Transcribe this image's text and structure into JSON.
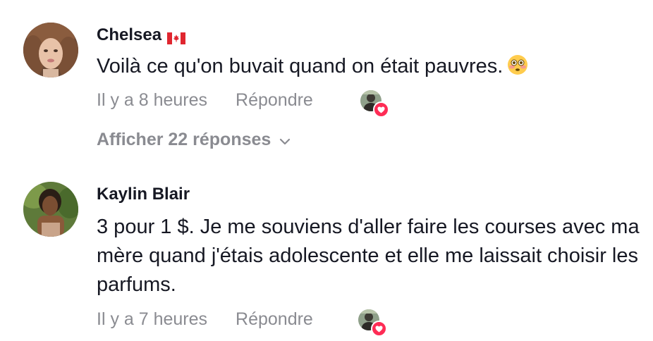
{
  "comments": [
    {
      "username": "Chelsea",
      "flag_icon": "canada-flag-icon",
      "text": "Voilà ce qu'on buvait quand on était pauvres.",
      "emoji_icon": "flushed-face-emoji",
      "time": "Il y a 8 heures",
      "reply_label": "Répondre",
      "view_replies_label": "Afficher 22 réponses"
    },
    {
      "username": "Kaylin Blair",
      "text": "3 pour 1 $. Je me souviens d'aller faire les courses avec ma mère quand j'étais adolescente et elle me laissait choisir les parfums.",
      "time": "Il y a 7 heures",
      "reply_label": "Répondre"
    }
  ],
  "colors": {
    "text": "#161823",
    "muted": "#8a8b91",
    "like": "#fe2c55"
  }
}
